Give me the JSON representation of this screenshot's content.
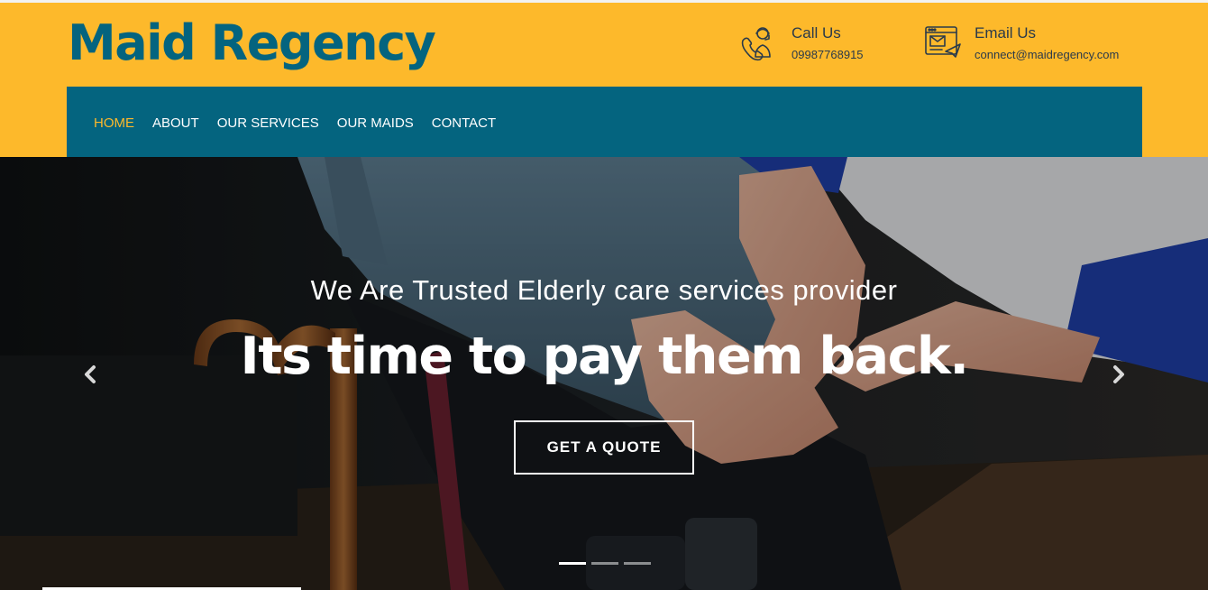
{
  "brand": {
    "name": "Maid Regency",
    "color": "#04647f",
    "accent": "#fdb92b"
  },
  "contact": {
    "call": {
      "title": "Call Us",
      "value": "09987768915",
      "icon": "phone-support-icon"
    },
    "email": {
      "title": "Email Us",
      "value": "connect@maidregency.com",
      "icon": "email-icon"
    }
  },
  "nav": {
    "items": [
      {
        "label": "HOME",
        "active": true
      },
      {
        "label": "ABOUT"
      },
      {
        "label": "OUR SERVICES"
      },
      {
        "label": "OUR MAIDS"
      },
      {
        "label": "CONTACT"
      }
    ]
  },
  "hero": {
    "subtitle": "We Are Trusted Elderly care services provider",
    "title": "Its time to pay them back.",
    "cta": "GET A QUOTE",
    "slides": 3,
    "active_slide": 1,
    "prev_icon": "chevron-left-icon",
    "next_icon": "chevron-right-icon"
  }
}
